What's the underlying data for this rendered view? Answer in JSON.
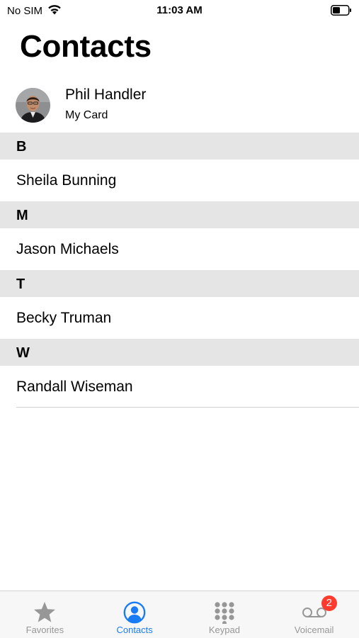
{
  "status_bar": {
    "carrier": "No SIM",
    "time": "11:03 AM"
  },
  "title": "Contacts",
  "my_card": {
    "name": "Phil Handler",
    "subtitle": "My Card"
  },
  "sections": [
    {
      "letter": "B",
      "contacts": [
        "Sheila Bunning"
      ]
    },
    {
      "letter": "M",
      "contacts": [
        "Jason Michaels"
      ]
    },
    {
      "letter": "T",
      "contacts": [
        "Becky Truman"
      ]
    },
    {
      "letter": "W",
      "contacts": [
        "Randall Wiseman"
      ]
    }
  ],
  "tab_bar": {
    "active_color": "#1a7cf5",
    "inactive_color": "#979797",
    "tabs": [
      {
        "label": "Favorites",
        "icon": "star-icon",
        "active": false
      },
      {
        "label": "Contacts",
        "icon": "person-circle-icon",
        "active": true
      },
      {
        "label": "Keypad",
        "icon": "keypad-icon",
        "active": false
      },
      {
        "label": "Voicemail",
        "icon": "voicemail-icon",
        "active": false,
        "badge": "2"
      }
    ]
  }
}
